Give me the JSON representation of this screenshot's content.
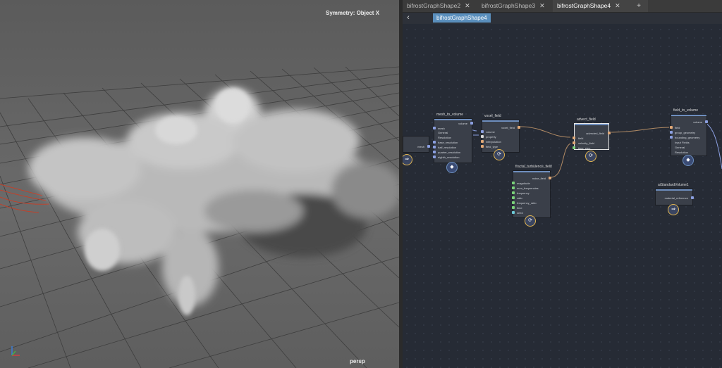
{
  "viewport": {
    "symmetry_label": "Symmetry: Object X",
    "camera_label": "persp"
  },
  "graph": {
    "tabs": [
      {
        "label": "bifrostGraphShape2",
        "active": false
      },
      {
        "label": "bifrostGraphShape3",
        "active": false
      },
      {
        "label": "bifrostGraphShape4",
        "active": true
      }
    ],
    "tab_close": "✕",
    "add_tab": "+",
    "back_icon": "‹",
    "breadcrumb": "bifrostGraphShape4",
    "nodes": {
      "input": {
        "port": "mesh"
      },
      "mesh_to_volume": {
        "title": "mesh_to_volume",
        "out": "volume",
        "ports": [
          "mesh",
          "General",
          "Resolution",
          "base_resolution",
          "half_resolution",
          "quarter_resolution",
          "eighth_resolution"
        ]
      },
      "voxel_field": {
        "title": "voxel_field",
        "out": "voxel_field",
        "ports": [
          "volume",
          "property",
          "interpolation",
          "field_type"
        ]
      },
      "advect_field": {
        "title": "advect_field",
        "out": "advected_field",
        "ports": [
          "field",
          "velocity_field",
          "time_step"
        ]
      },
      "fractal_turbulence_field": {
        "title": "fractal_turbulence_field",
        "out": "noise_field",
        "ports": [
          "magnitude",
          "num_frequencies",
          "frequency",
          "ratio",
          "frequency_ratio",
          "time",
          "seed"
        ]
      },
      "field_to_volume": {
        "title": "field_to_volume",
        "out": "volume",
        "ports": [
          "field",
          "group_geometry",
          "bounding_geometry",
          "Input Fields",
          "General",
          "Resolution"
        ]
      },
      "standard_volume": {
        "title": "aiStandardVolume1",
        "out": "material_reference"
      }
    }
  },
  "colors": {
    "viewport_bg": "#626262",
    "graph_bg": "#262b35",
    "node_bg": "#3a3f49",
    "breadcrumb": "#5a8fbd",
    "wire": "#b08a64"
  }
}
